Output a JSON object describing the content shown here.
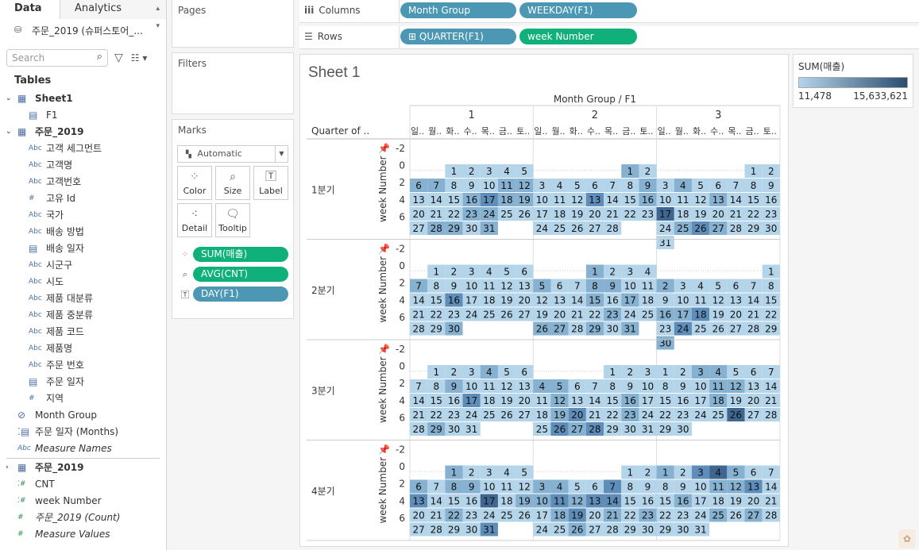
{
  "tabs": {
    "data": "Data",
    "analytics": "Analytics"
  },
  "datasource": "주문_2019 (슈퍼스토어_...",
  "search": {
    "placeholder": "Search"
  },
  "tables_label": "Tables",
  "fields": [
    {
      "label": "Sheet1",
      "icon": "table",
      "caret": "expanded",
      "bold": true,
      "indent": 0
    },
    {
      "label": "F1",
      "icon": "date",
      "indent": 1
    },
    {
      "label": "주문_2019",
      "icon": "table",
      "caret": "expanded",
      "bold": true,
      "indent": 0
    },
    {
      "label": "고객 세그먼트",
      "icon": "Abc",
      "indent": 1
    },
    {
      "label": "고객명",
      "icon": "Abc",
      "indent": 1
    },
    {
      "label": "고객번호",
      "icon": "Abc",
      "indent": 1
    },
    {
      "label": "고유 Id",
      "icon": "#",
      "indent": 1
    },
    {
      "label": "국가",
      "icon": "Abc",
      "indent": 1
    },
    {
      "label": "배송 방법",
      "icon": "Abc",
      "indent": 1
    },
    {
      "label": "배송 일자",
      "icon": "date",
      "indent": 1
    },
    {
      "label": "시군구",
      "icon": "Abc",
      "indent": 1
    },
    {
      "label": "시도",
      "icon": "Abc",
      "indent": 1
    },
    {
      "label": "제품 대분류",
      "icon": "Abc",
      "indent": 1
    },
    {
      "label": "제품 중분류",
      "icon": "Abc",
      "indent": 1
    },
    {
      "label": "제품 코드",
      "icon": "Abc",
      "indent": 1
    },
    {
      "label": "제품명",
      "icon": "Abc",
      "indent": 1
    },
    {
      "label": "주문 번호",
      "icon": "Abc",
      "indent": 1
    },
    {
      "label": "주문 일자",
      "icon": "date",
      "indent": 1
    },
    {
      "label": "지역",
      "icon": "#",
      "indent": 1
    },
    {
      "label": "Month Group",
      "icon": "clip",
      "indent": 0
    },
    {
      "label": "주문 일자 (Months)",
      "icon": "dates",
      "indent": 0
    },
    {
      "label": "Measure Names",
      "icon": "Abc",
      "indent": 0,
      "italic": true
    },
    {
      "label": "주문_2019",
      "icon": "table",
      "caret": "collapsed",
      "bold": true,
      "indent": 0,
      "separator": true
    },
    {
      "label": "CNT",
      "icon": "#=",
      "indent": 0,
      "green": true
    },
    {
      "label": "week Number",
      "icon": "#=",
      "indent": 0,
      "green": true
    },
    {
      "label": "주문_2019 (Count)",
      "icon": "#",
      "indent": 0,
      "italic": true,
      "green": true
    },
    {
      "label": "Measure Values",
      "icon": "#",
      "indent": 0,
      "italic": true,
      "green": true
    }
  ],
  "pages_label": "Pages",
  "filters_label": "Filters",
  "marks": {
    "title": "Marks",
    "type": "Automatic",
    "buttons": [
      "Color",
      "Size",
      "Label",
      "Detail",
      "Tooltip"
    ],
    "pills": [
      {
        "label": "SUM(매출)",
        "icon": "color-dots",
        "color": "green"
      },
      {
        "label": "AVG(CNT)",
        "icon": "size-shapes",
        "color": "green"
      },
      {
        "label": "DAY(F1)",
        "icon": "label-T",
        "color": "blue"
      }
    ]
  },
  "shelves": {
    "columns_label": "Columns",
    "rows_label": "Rows",
    "columns": [
      {
        "label": "Month Group",
        "color": "blue"
      },
      {
        "label": "WEEKDAY(F1)",
        "color": "blue"
      }
    ],
    "rows": [
      {
        "label": "⊞ QUARTER(F1)",
        "color": "blue"
      },
      {
        "label": "week Number",
        "color": "green"
      }
    ]
  },
  "sheet_title": "Sheet 1",
  "legend": {
    "title": "SUM(매출)",
    "min": "11,478",
    "max": "15,633,621",
    "color_low": "#b4d4ea",
    "color_high": "#2b4d6e"
  },
  "chart_data": {
    "type": "heatmap",
    "header_title": "Month Group / F1",
    "row_header_title": "Quarter of ..",
    "axis_label": "week Number",
    "axis_ticks": [
      "-2",
      "0",
      "2",
      "4",
      "6"
    ],
    "month_groups": [
      "1",
      "2",
      "3"
    ],
    "weekdays": [
      "일..",
      "월..",
      "화..",
      "수..",
      "목..",
      "금..",
      "토.."
    ],
    "quarters": [
      {
        "label": "1분기",
        "groups": [
          {
            "first_weekday": 2,
            "days": 31,
            "colors": [
              0,
              0,
              0,
              0,
              0,
              1,
              1,
              0,
              0,
              0,
              1,
              1,
              0,
              0,
              0,
              1,
              2,
              1,
              1,
              0,
              0,
              0,
              1,
              1,
              0,
              0,
              0,
              1,
              1,
              0,
              1
            ]
          },
          {
            "first_weekday": 5,
            "days": 28,
            "colors": [
              1,
              0,
              0,
              0,
              0,
              0,
              0,
              0,
              1,
              0,
              0,
              0,
              2,
              0,
              0,
              1,
              0,
              0,
              0,
              0,
              0,
              0,
              0,
              0,
              0,
              0,
              0,
              0
            ]
          },
          {
            "first_weekday": 5,
            "days": 31,
            "colors": [
              0,
              0,
              0,
              1,
              0,
              0,
              0,
              0,
              0,
              0,
              0,
              0,
              1,
              0,
              0,
              0,
              3,
              0,
              0,
              0,
              0,
              0,
              0,
              0,
              1,
              2,
              1,
              0,
              0,
              0,
              0
            ]
          }
        ]
      },
      {
        "label": "2분기",
        "groups": [
          {
            "first_weekday": 1,
            "days": 30,
            "colors": [
              0,
              0,
              0,
              0,
              0,
              0,
              1,
              0,
              0,
              0,
              0,
              0,
              0,
              0,
              0,
              2,
              0,
              0,
              0,
              0,
              0,
              0,
              0,
              0,
              0,
              0,
              0,
              0,
              0,
              1
            ]
          },
          {
            "first_weekday": 3,
            "days": 31,
            "colors": [
              1,
              0,
              0,
              0,
              1,
              0,
              0,
              1,
              1,
              0,
              0,
              0,
              0,
              0,
              1,
              0,
              1,
              0,
              0,
              0,
              0,
              0,
              1,
              0,
              0,
              1,
              1,
              0,
              1,
              0,
              1
            ]
          },
          {
            "first_weekday": 6,
            "days": 30,
            "colors": [
              0,
              1,
              0,
              0,
              0,
              0,
              0,
              0,
              0,
              0,
              0,
              0,
              0,
              0,
              0,
              1,
              1,
              2,
              0,
              0,
              0,
              0,
              0,
              2,
              0,
              0,
              0,
              0,
              0,
              1
            ]
          }
        ]
      },
      {
        "label": "3분기",
        "groups": [
          {
            "first_weekday": 1,
            "days": 31,
            "colors": [
              0,
              0,
              0,
              1,
              0,
              0,
              0,
              0,
              1,
              0,
              0,
              0,
              0,
              0,
              0,
              0,
              2,
              0,
              0,
              0,
              0,
              0,
              0,
              0,
              0,
              0,
              0,
              0,
              1,
              0,
              0
            ]
          },
          {
            "first_weekday": 4,
            "days": 31,
            "colors": [
              0,
              0,
              0,
              1,
              1,
              0,
              0,
              0,
              0,
              0,
              0,
              1,
              0,
              0,
              0,
              1,
              0,
              0,
              1,
              2,
              0,
              0,
              1,
              0,
              0,
              2,
              1,
              2,
              0,
              0,
              0
            ]
          },
          {
            "first_weekday": 0,
            "days": 30,
            "colors": [
              0,
              0,
              1,
              1,
              0,
              0,
              0,
              0,
              0,
              0,
              1,
              1,
              0,
              0,
              0,
              0,
              0,
              1,
              0,
              0,
              0,
              0,
              0,
              0,
              0,
              3,
              0,
              0,
              0,
              0
            ]
          }
        ]
      },
      {
        "label": "4분기",
        "groups": [
          {
            "first_weekday": 2,
            "days": 31,
            "colors": [
              1,
              0,
              0,
              0,
              0,
              1,
              0,
              1,
              1,
              0,
              0,
              0,
              2,
              0,
              0,
              0,
              3,
              0,
              1,
              0,
              0,
              1,
              0,
              0,
              0,
              0,
              0,
              0,
              0,
              0,
              2
            ]
          },
          {
            "first_weekday": 5,
            "days": 30,
            "colors": [
              0,
              0,
              1,
              1,
              0,
              0,
              2,
              0,
              0,
              1,
              2,
              1,
              2,
              2,
              0,
              0,
              0,
              1,
              2,
              0,
              1,
              0,
              1,
              0,
              0,
              1,
              0,
              0,
              0,
              0
            ]
          },
          {
            "first_weekday": 0,
            "days": 31,
            "colors": [
              1,
              0,
              2,
              3,
              1,
              0,
              0,
              0,
              0,
              0,
              1,
              1,
              2,
              0,
              0,
              1,
              0,
              0,
              0,
              0,
              0,
              0,
              0,
              0,
              1,
              0,
              1,
              0,
              0,
              0,
              0
            ]
          }
        ]
      }
    ],
    "palette": [
      "#b4d4ea",
      "#86b1d0",
      "#5d8db8",
      "#3f6690"
    ]
  }
}
